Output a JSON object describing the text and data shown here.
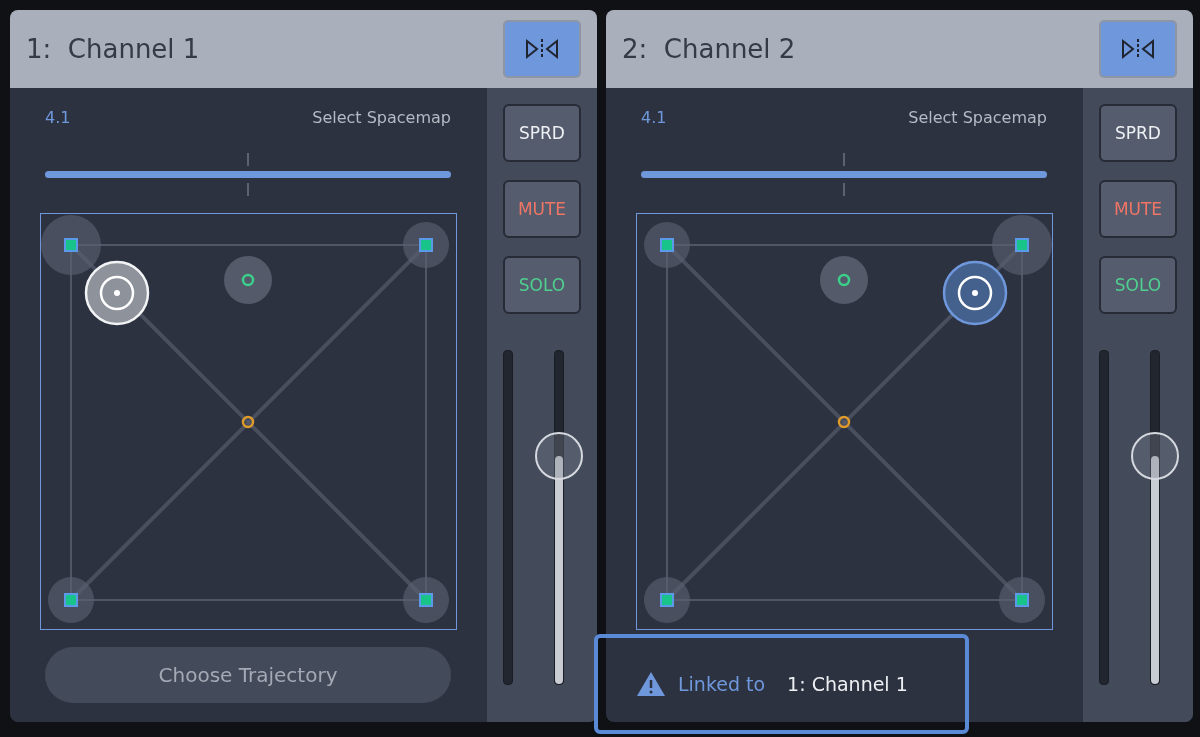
{
  "channels": [
    {
      "title": "1:  Channel 1",
      "mirror_active": true,
      "spacemap_value": "4.1",
      "spacemap_label": "Select Spacemap",
      "width_slider": {
        "level": 1
      },
      "buttons": [
        {
          "label": "SPRD",
          "kind": "spread"
        },
        {
          "label": "MUTE",
          "kind": "mute"
        },
        {
          "label": "SOLO",
          "kind": "solo"
        }
      ],
      "fader": {
        "level": 0.68
      },
      "speakers": [
        {
          "near_source": true
        },
        {
          "near_source": false
        },
        {
          "near_source": false
        },
        {
          "near_source": false
        }
      ],
      "source": {
        "selected": false
      },
      "footer": {
        "kind": "button",
        "label": "Choose Trajectory"
      }
    },
    {
      "title": "2:  Channel 2",
      "mirror_active": true,
      "spacemap_value": "4.1",
      "spacemap_label": "Select Spacemap",
      "width_slider": {
        "level": 1
      },
      "buttons": [
        {
          "label": "SPRD",
          "kind": "spread"
        },
        {
          "label": "MUTE",
          "kind": "mute"
        },
        {
          "label": "SOLO",
          "kind": "solo"
        }
      ],
      "fader": {
        "level": 0.68
      },
      "speakers": [
        {
          "near_source": false
        },
        {
          "near_source": true
        },
        {
          "near_source": false
        },
        {
          "near_source": false
        }
      ],
      "source": {
        "selected": true
      },
      "footer": {
        "kind": "link",
        "label": "Linked to",
        "target": "1: Channel 1"
      }
    }
  ]
}
